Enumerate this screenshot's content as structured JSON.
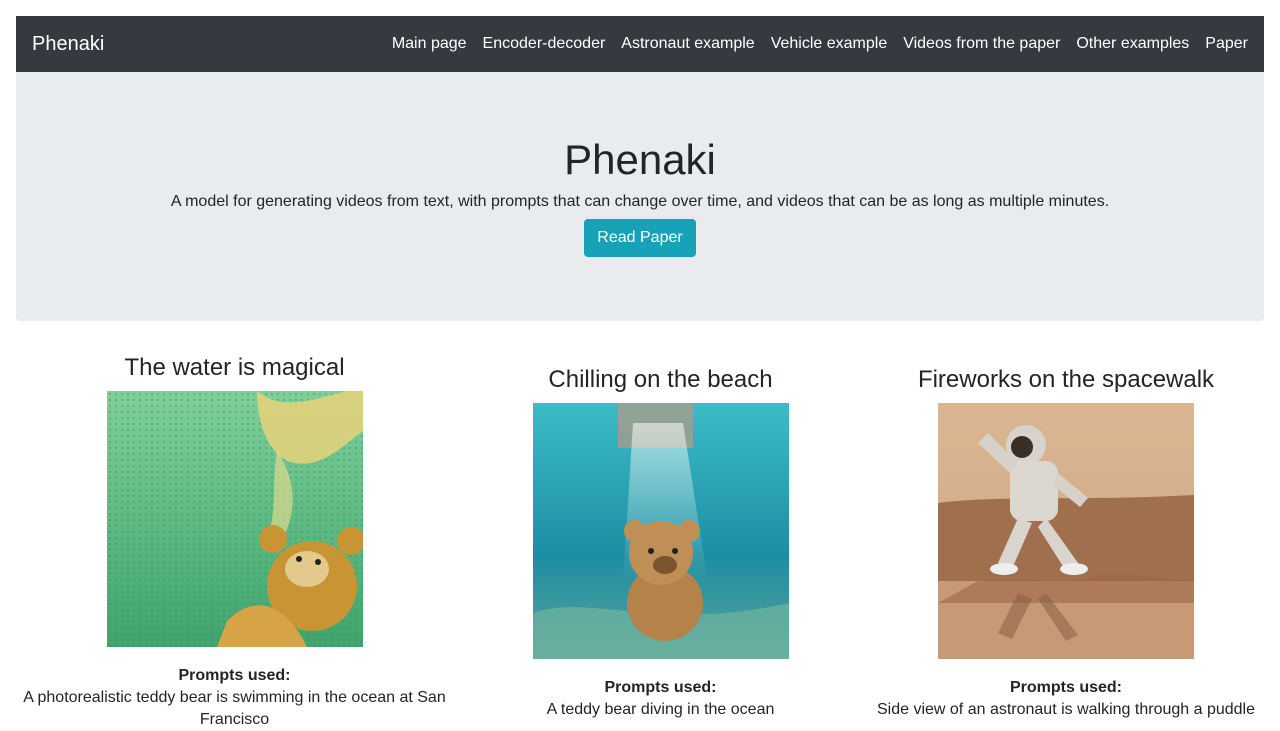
{
  "navbar": {
    "brand": "Phenaki",
    "links": [
      "Main page",
      "Encoder-decoder",
      "Astronaut example",
      "Vehicle example",
      "Videos from the paper",
      "Other examples",
      "Paper"
    ]
  },
  "hero": {
    "title": "Phenaki",
    "subtitle": "A model for generating videos from text, with prompts that can change over time, and videos that can be as long as multiple minutes.",
    "button": "Read Paper"
  },
  "examples": [
    {
      "title": "The water is magical",
      "prompts_label": "Prompts used:",
      "prompt": "A photorealistic teddy bear is swimming in the ocean at San Francisco"
    },
    {
      "title": "Chilling on the beach",
      "prompts_label": "Prompts used:",
      "prompt": "A teddy bear diving in the ocean"
    },
    {
      "title": "Fireworks on the spacewalk",
      "prompts_label": "Prompts used:",
      "prompt": "Side view of an astronaut is walking through a puddle"
    }
  ],
  "colors": {
    "navbar_bg": "#343a40",
    "hero_bg": "#e9ecef",
    "button_bg": "#17a2b8"
  }
}
